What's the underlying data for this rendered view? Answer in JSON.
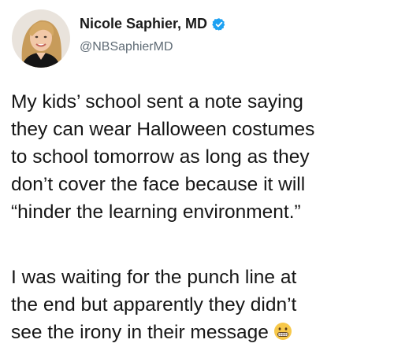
{
  "author": {
    "name": "Nicole Saphier, MD",
    "handle": "@NBSaphierMD",
    "verified_icon": "verified-badge-icon",
    "verified_color": "#1da1f2"
  },
  "tweet": {
    "paragraph1": [
      "My kids’ school sent a note saying",
      "they can wear Halloween costumes",
      "to school tomorrow as long as they",
      "don’t cover the face because it will",
      "“hinder the learning environment.”"
    ],
    "paragraph2": [
      "I was waiting for the punch line at",
      "the end but apparently they didn’t",
      "see the irony in their message"
    ],
    "trailing_emoji": "grimacing-face-emoji"
  }
}
